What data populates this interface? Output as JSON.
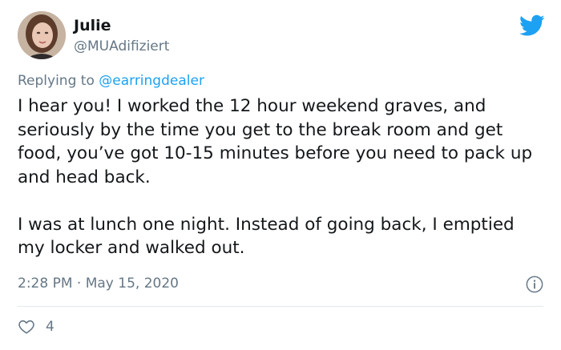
{
  "author": {
    "display_name": "Julie",
    "handle": "@MUAdifiziert",
    "avatar_icon": "avatar-photo"
  },
  "reply": {
    "prefix": "Replying to ",
    "mention": "@earringdealer"
  },
  "paragraphs": [
    "I hear you! I worked the 12 hour weekend graves, and seriously by the time you get to the break room and get food, you’ve got 10-15 minutes before you need to pack up and head back.",
    "I was at lunch one night. Instead of going back, I emptied my locker and walked out."
  ],
  "meta": {
    "timestamp": "2:28 PM · May 15, 2020"
  },
  "engagement": {
    "likes": "4"
  },
  "colors": {
    "brand": "#1da1f2",
    "text": "#14171a",
    "secondary": "#657786",
    "divider": "#e1e8ed"
  },
  "icons": [
    "twitter-bird-icon",
    "info-icon",
    "heart-icon"
  ]
}
